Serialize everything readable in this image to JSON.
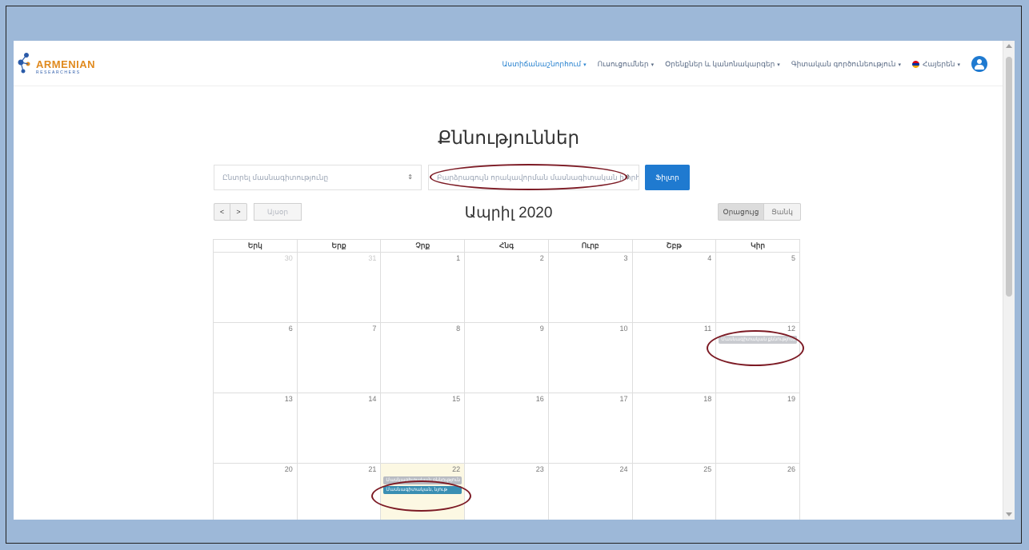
{
  "nav": {
    "logo_text": "ARMENIAN",
    "logo_subtext": "RESEARCHERS",
    "items": [
      {
        "label": "Աստիճանաշնորհում",
        "active": true
      },
      {
        "label": "Ուսուցումներ",
        "active": false
      },
      {
        "label": "Օրենքներ և կանոնակարգեր",
        "active": false
      },
      {
        "label": "Գիտական գործունեություն",
        "active": false
      },
      {
        "label": "Հայերեն",
        "active": false
      }
    ]
  },
  "page_title": "Քննություններ",
  "filters": {
    "specialty_placeholder": "Ընտրել մասնագիտությունը",
    "council_placeholder": "Բարձրագույն որակավորման մասնագիտական խորհուրդ...",
    "filter_button": "Ֆիլտր"
  },
  "toolbar": {
    "prev": "<",
    "next": ">",
    "today": "Այսօր",
    "month_title": "Ապրիլ 2020",
    "week_view": "Օրացույց",
    "month_view": "Ցանկ"
  },
  "calendar": {
    "weekdays": [
      "Երկ",
      "Երք",
      "Չրք",
      "Հնգ",
      "Ուրբ",
      "Շբթ",
      "Կիր"
    ],
    "weeks": [
      [
        "30",
        "31",
        "1",
        "2",
        "3",
        "4",
        "5"
      ],
      [
        "6",
        "7",
        "8",
        "9",
        "10",
        "11",
        "12"
      ],
      [
        "13",
        "14",
        "15",
        "16",
        "17",
        "18",
        "19"
      ],
      [
        "20",
        "21",
        "22",
        "23",
        "24",
        "25",
        "26"
      ]
    ],
    "events": {
      "apr12": "Մասնագիտական քննություն",
      "apr22_1": "Մասնագիտական քննություն",
      "apr22_2": "Մասնագիտական, նյութ"
    }
  },
  "colors": {
    "accent": "#1f7ad0",
    "highlight_oval": "#7c1a24",
    "background": "#9db8d8"
  }
}
